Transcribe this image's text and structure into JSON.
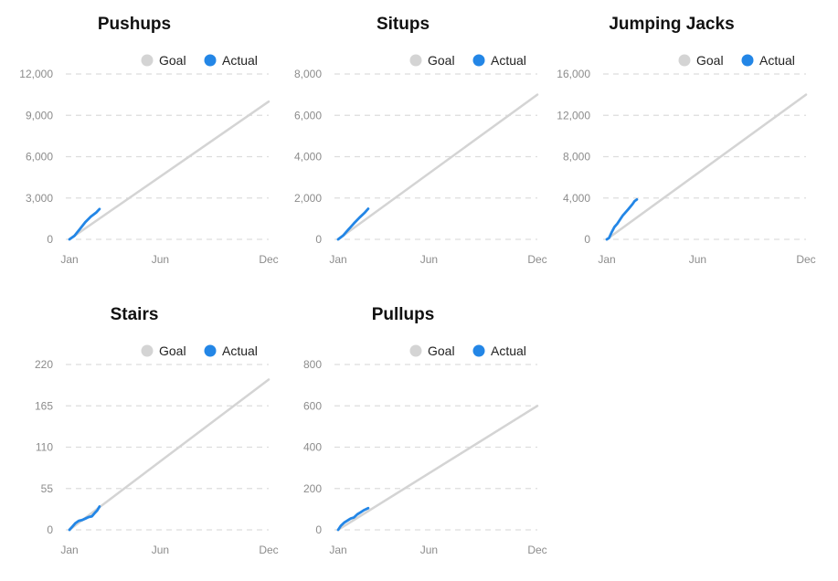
{
  "colors": {
    "goal": "#d4d4d4",
    "actual": "#2386e6",
    "grid": "#dddddd"
  },
  "chart_data": [
    {
      "type": "line",
      "title": "Pushups",
      "legend": [
        "Goal",
        "Actual"
      ],
      "legend_placement": "top-right",
      "grid": true,
      "x_ticks": [
        "Jan",
        "Jun",
        "Dec"
      ],
      "y_ticks": [
        "0",
        "3,000",
        "6,000",
        "9,000",
        "12,000"
      ],
      "ylim": [
        0,
        12000
      ],
      "series": [
        {
          "name": "Goal",
          "x": [
            1,
            365
          ],
          "y": [
            0,
            10000
          ]
        },
        {
          "name": "Actual",
          "x": [
            1,
            10,
            20,
            30,
            40,
            50,
            56
          ],
          "y": [
            0,
            250,
            750,
            1250,
            1650,
            1950,
            2200
          ]
        }
      ]
    },
    {
      "type": "line",
      "title": "Situps",
      "legend": [
        "Goal",
        "Actual"
      ],
      "legend_placement": "top-right",
      "grid": true,
      "x_ticks": [
        "Jan",
        "Jun",
        "Dec"
      ],
      "y_ticks": [
        "0",
        "2,000",
        "4,000",
        "6,000",
        "8,000"
      ],
      "ylim": [
        0,
        8000
      ],
      "series": [
        {
          "name": "Goal",
          "x": [
            1,
            365
          ],
          "y": [
            0,
            7000
          ]
        },
        {
          "name": "Actual",
          "x": [
            1,
            10,
            20,
            30,
            40,
            50,
            56
          ],
          "y": [
            0,
            180,
            480,
            780,
            1050,
            1300,
            1480
          ]
        }
      ]
    },
    {
      "type": "line",
      "title": "Jumping Jacks",
      "legend": [
        "Goal",
        "Actual"
      ],
      "legend_placement": "top-right",
      "grid": true,
      "x_ticks": [
        "Jan",
        "Jun",
        "Dec"
      ],
      "y_ticks": [
        "0",
        "4,000",
        "8,000",
        "12,000",
        "16,000"
      ],
      "ylim": [
        0,
        16000
      ],
      "series": [
        {
          "name": "Goal",
          "x": [
            1,
            365
          ],
          "y": [
            0,
            14000
          ]
        },
        {
          "name": "Actual",
          "x": [
            1,
            5,
            10,
            15,
            20,
            30,
            40,
            48,
            52,
            56
          ],
          "y": [
            0,
            120,
            700,
            1200,
            1500,
            2300,
            2900,
            3400,
            3700,
            3850
          ]
        }
      ]
    },
    {
      "type": "line",
      "title": "Stairs",
      "legend": [
        "Goal",
        "Actual"
      ],
      "legend_placement": "top-right",
      "grid": true,
      "x_ticks": [
        "Jan",
        "Jun",
        "Dec"
      ],
      "y_ticks": [
        "0",
        "55",
        "110",
        "165",
        "220"
      ],
      "ylim": [
        0,
        220
      ],
      "series": [
        {
          "name": "Goal",
          "x": [
            1,
            365
          ],
          "y": [
            0,
            200
          ]
        },
        {
          "name": "Actual",
          "x": [
            1,
            6,
            12,
            18,
            24,
            30,
            36,
            42,
            48,
            52,
            56
          ],
          "y": [
            0,
            4,
            9,
            12,
            13,
            15,
            17,
            18,
            23,
            26,
            31
          ]
        }
      ]
    },
    {
      "type": "line",
      "title": "Pullups",
      "legend": [
        "Goal",
        "Actual"
      ],
      "legend_placement": "top-right",
      "grid": true,
      "x_ticks": [
        "Jan",
        "Jun",
        "Dec"
      ],
      "y_ticks": [
        "0",
        "200",
        "400",
        "600",
        "800"
      ],
      "ylim": [
        0,
        800
      ],
      "series": [
        {
          "name": "Goal",
          "x": [
            1,
            365
          ],
          "y": [
            0,
            600
          ]
        },
        {
          "name": "Actual",
          "x": [
            1,
            6,
            12,
            18,
            24,
            30,
            36,
            42,
            48,
            52,
            56
          ],
          "y": [
            0,
            20,
            35,
            45,
            55,
            60,
            75,
            85,
            95,
            100,
            105
          ]
        }
      ]
    }
  ]
}
